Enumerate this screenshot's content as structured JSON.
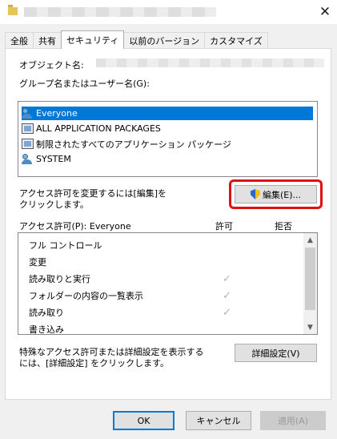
{
  "window": {
    "close_glyph": "✕"
  },
  "tabs": [
    {
      "label": "全般"
    },
    {
      "label": "共有"
    },
    {
      "label": "セキュリティ"
    },
    {
      "label": "以前のバージョン"
    },
    {
      "label": "カスタマイズ"
    }
  ],
  "object_name_label": "オブジェクト名:",
  "group_label": "グループ名またはユーザー名(G):",
  "principals": [
    {
      "name": "Everyone",
      "icon": "users-icon"
    },
    {
      "name": "ALL APPLICATION PACKAGES",
      "icon": "package-icon"
    },
    {
      "name": "制限されたすべてのアプリケーション パッケージ",
      "icon": "package-icon"
    },
    {
      "name": "SYSTEM",
      "icon": "users-icon"
    }
  ],
  "change_hint_line1": "アクセス許可を変更するには[編集]を",
  "change_hint_line2": "クリックします。",
  "edit_button": "編集(E)...",
  "permissions": {
    "header": "アクセス許可(P): Everyone",
    "allow_header": "許可",
    "deny_header": "拒否",
    "rows": [
      {
        "name": "フル コントロール",
        "allow": false
      },
      {
        "name": "変更",
        "allow": false
      },
      {
        "name": "読み取りと実行",
        "allow": true
      },
      {
        "name": "フォルダーの内容の一覧表示",
        "allow": true
      },
      {
        "name": "読み取り",
        "allow": true
      },
      {
        "name": "書き込み",
        "allow": false
      }
    ],
    "check_glyph": "✓",
    "scroll_up_glyph": "▲",
    "scroll_down_glyph": "▼"
  },
  "advanced_hint_line1": "特殊なアクセス許可または詳細設定を表示する",
  "advanced_hint_line2": "には、[詳細設定] をクリックします。",
  "advanced_button": "詳細設定(V)",
  "footer": {
    "ok": "OK",
    "cancel": "キャンセル",
    "apply": "適用(A)"
  },
  "colors": {
    "selection": "#0078d7",
    "highlight": "#e01010"
  }
}
